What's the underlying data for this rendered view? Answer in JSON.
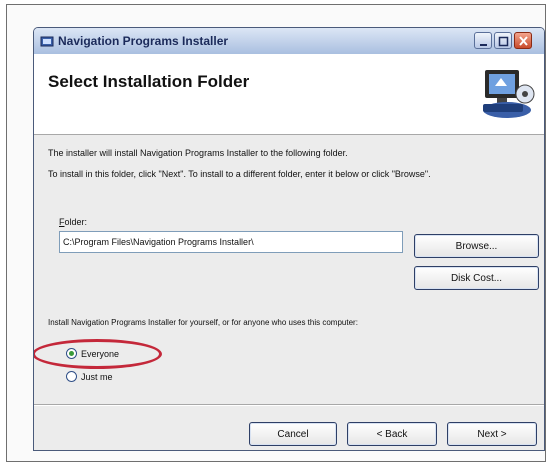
{
  "window": {
    "title": "Navigation Programs Installer"
  },
  "header": {
    "title": "Select Installation Folder",
    "graphic_icon": "computer-installer-icon"
  },
  "body": {
    "line1": "The installer will install Navigation Programs Installer to the following folder.",
    "line2": "To install in this folder, click \"Next\". To install to a different folder, enter it below or click \"Browse\"."
  },
  "folder": {
    "label_accel": "F",
    "label_rest": "older:",
    "value": "C:\\Program Files\\Navigation Programs Installer\\",
    "browse_label": "Browse...",
    "disk_cost_label": "Disk Cost..."
  },
  "install_for": {
    "prompt": "Install Navigation Programs Installer for yourself, or for anyone who uses this computer:",
    "options": [
      {
        "label": "Everyone",
        "selected": true
      },
      {
        "label": "Just me",
        "selected": false
      }
    ],
    "highlight_color": "#c4283a"
  },
  "footer": {
    "cancel_label": "Cancel",
    "back_label": "< Back",
    "next_label": "Next >"
  }
}
